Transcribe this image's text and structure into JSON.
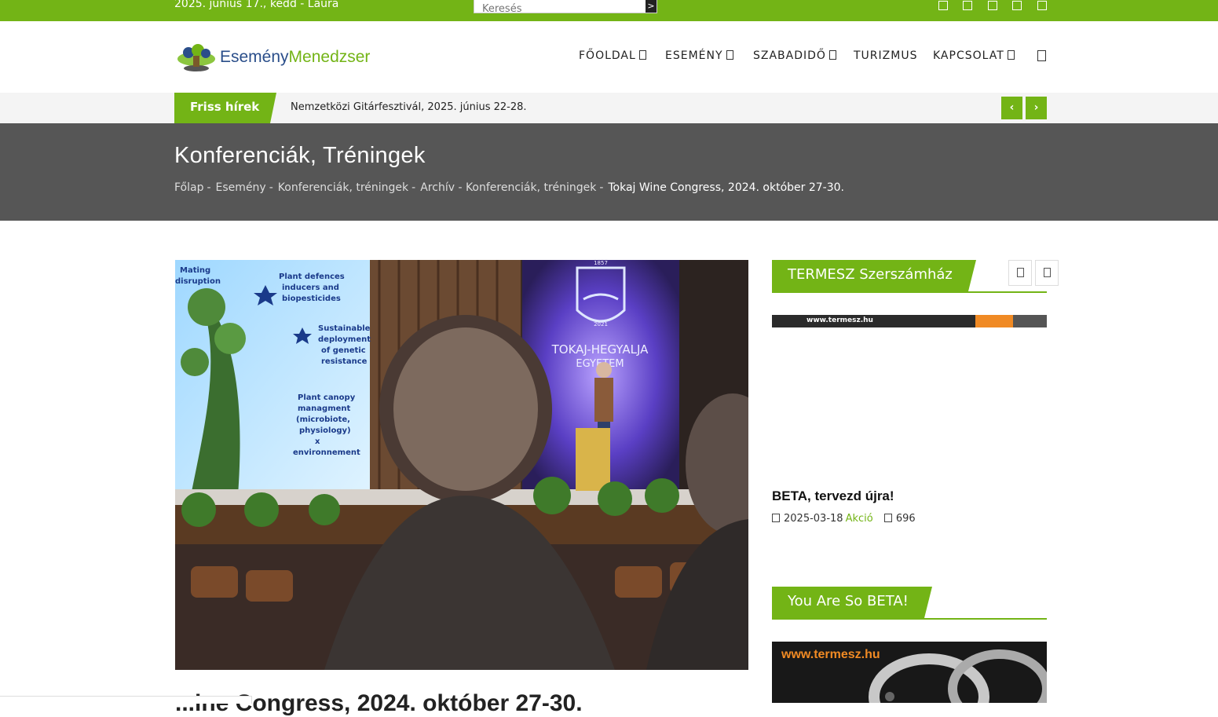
{
  "topbar": {
    "date_text": "2025. június 17., kedd - Laura",
    "search_placeholder": "Keresés",
    "search_button_label": ">",
    "social_icons": [
      "facebook-icon",
      "twitter-icon",
      "youtube-icon",
      "instagram-icon",
      "rss-icon"
    ]
  },
  "logo": {
    "part1": "Esemény",
    "part2": "Menedzser"
  },
  "nav": {
    "items": [
      {
        "label": "FŐOLDAL"
      },
      {
        "label": "ESEMÉNY"
      },
      {
        "label": "SZABADIDŐ"
      },
      {
        "label": "TURIZMUS"
      },
      {
        "label": "KAPCSOLAT"
      }
    ]
  },
  "ticker": {
    "label": "Friss hírek",
    "headline": "Nemzetközi Gitárfesztivál, 2025. június 22-28.",
    "prev_label": "‹",
    "next_label": "›"
  },
  "page": {
    "title": "Konferenciák, Tréningek",
    "breadcrumb": [
      "Főlap",
      "Esemény",
      "Konferenciák, tréningek",
      "Archív - Konferenciák, tréningek"
    ],
    "breadcrumb_current": "Tokaj Wine Congress, 2024. október 27-30.",
    "separator": "-"
  },
  "photo": {
    "slide_lines": [
      "Mating",
      "disruption",
      "Plant defences",
      "inducers and",
      "biopesticides",
      "Sustainable",
      "deployment",
      "of genetic",
      "resistance",
      "Plant canopy",
      "managment",
      "(microbiote,",
      "physiology)",
      "x",
      "environnement"
    ],
    "banner_year_top": "1857",
    "banner_year": "2021",
    "banner_title1": "TOKAJ-HEGYALJA",
    "banner_title2": "EGYETEM"
  },
  "article": {
    "title_partial": "...ine Congress, 2024. október 27-30."
  },
  "sidebar": {
    "widget1_title": "TERMESZ Szerszámház",
    "ad1_url": "www.termesz.hu",
    "post_title": "BETA, tervezd újra!",
    "post_date": "2025-03-18",
    "post_category": "Akció",
    "post_views": "696",
    "widget2_title": "You Are So BETA!",
    "ad2_url": "www.termesz.hu"
  },
  "colors": {
    "accent": "#73b416",
    "band": "#565656",
    "ticker_bg": "#f4f4f4"
  }
}
